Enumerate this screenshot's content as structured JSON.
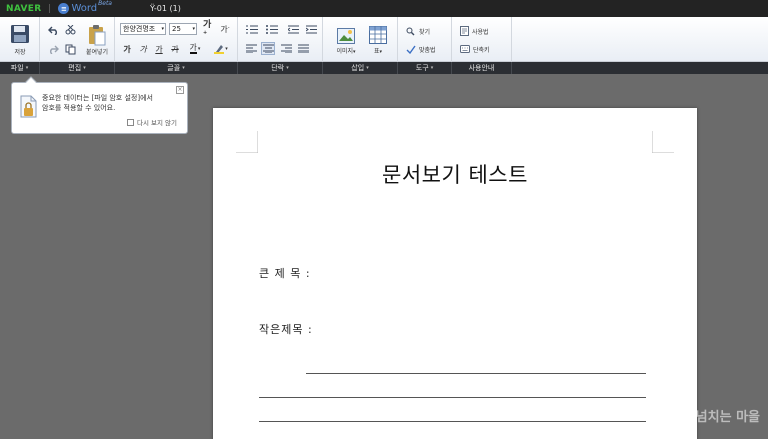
{
  "titlebar": {
    "brand": "NAVER",
    "product": "Word",
    "beta": "Beta",
    "document_title": "Ÿ-01 (1)"
  },
  "ribbon": {
    "save_label": "저장",
    "paste_label": "붙여넣기",
    "font_name": "한양견명조",
    "font_size": "25",
    "image_label": "이미지",
    "table_label": "표",
    "find_label": "찾기",
    "spellcheck_label": "맞춤법",
    "usage_label": "사용법",
    "shortcut_label": "단축키",
    "bold_label": "가",
    "italic_label": "가",
    "underline_label": "가",
    "strike_label": "가",
    "color_label": "가"
  },
  "group_labels": {
    "file": "파일",
    "edit": "편집",
    "font": "글꼴",
    "paragraph": "단락",
    "insert": "삽입",
    "tools": "도구",
    "guide": "사용안내"
  },
  "tooltip": {
    "line1": "중요한 데이터는 [파일 암호 설정]에서",
    "line2": "암호를 적용할 수 있어요.",
    "checkbox_label": "다시 보지 않기"
  },
  "document": {
    "heading": "문서보기 테스트",
    "field1": "큰 제 목 :",
    "field2": "작은제목 :"
  },
  "watermark": "정이 넘치는 마을",
  "colors": {
    "naver_green": "#3fc23f",
    "word_blue": "#4a7fcf",
    "label_strip": "#2b2e33",
    "workspace": "#6b6b6b"
  }
}
